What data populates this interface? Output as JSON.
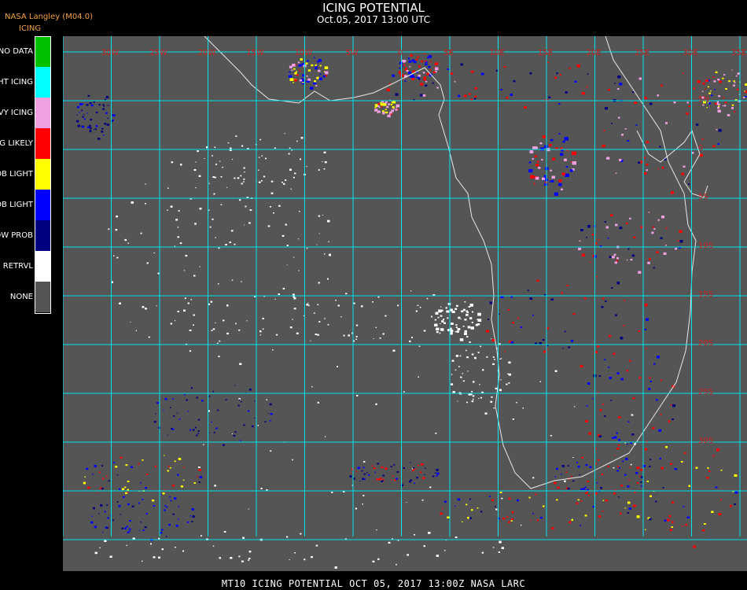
{
  "header": {
    "title": "ICING POTENTIAL",
    "subtitle": "Oct.05, 2017 13:00 UTC",
    "producer": "NASA Langley (M04.0)",
    "product": "ICING"
  },
  "legend": [
    {
      "label": "NO DATA",
      "color": "#00c000"
    },
    {
      "label": "NIGHT ICING",
      "color": "#00ffff"
    },
    {
      "label": "HEAVY ICING",
      "color": "#f0a0e0"
    },
    {
      "label": "MOG LIKELY",
      "color": "#ff0000"
    },
    {
      "label": "HI PROB LIGHT",
      "color": "#ffff00"
    },
    {
      "label": "LO PROB LIGHT",
      "color": "#0000ff"
    },
    {
      "label": "LOW PROB",
      "color": "#000080"
    },
    {
      "label": "NO RETRVL",
      "color": "#ffffff"
    },
    {
      "label": "NONE",
      "color": "#555555"
    }
  ],
  "map": {
    "background": "#555555",
    "grid_color": "#00e5ee",
    "coast_color": "#e8e8e8",
    "lat_label_color": "#cc2222",
    "lon_labels": [
      "30W",
      "25W",
      "20W",
      "15W",
      "10W",
      "5W",
      "0",
      "5E",
      "10E",
      "15E",
      "20E",
      "25E",
      "30E",
      "35E",
      "40E"
    ],
    "lat_labels": [
      "5N",
      "0",
      "5S",
      "10S",
      "15S",
      "20S",
      "25S",
      "30S"
    ]
  },
  "footer": {
    "text": "MT10  ICING POTENTIAL   OCT 05, 2017 13:00Z   NASA LARC"
  }
}
